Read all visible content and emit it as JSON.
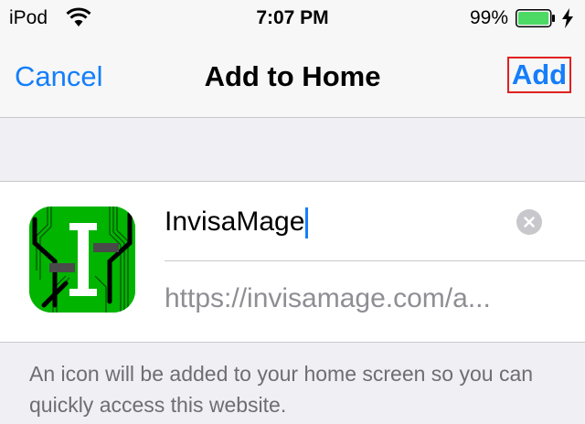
{
  "status_bar": {
    "carrier": "iPod",
    "time": "7:07 PM",
    "battery_percent": "99%",
    "battery_level": 0.99,
    "charging": true,
    "wifi_icon": "wifi-icon",
    "battery_icon": "battery-icon"
  },
  "nav": {
    "cancel_label": "Cancel",
    "title": "Add to Home",
    "add_label": "Add"
  },
  "bookmark": {
    "icon": "invisamage-app-icon",
    "name_value": "InvisaMage",
    "url_value": "https://invisamage.com/a..."
  },
  "footnote": "An icon will be added to your home screen so you can quickly access this website.",
  "colors": {
    "accent": "#147efb",
    "highlight_border": "#e0211f",
    "icon_green": "#00b400",
    "battery_green": "#4cd964"
  }
}
